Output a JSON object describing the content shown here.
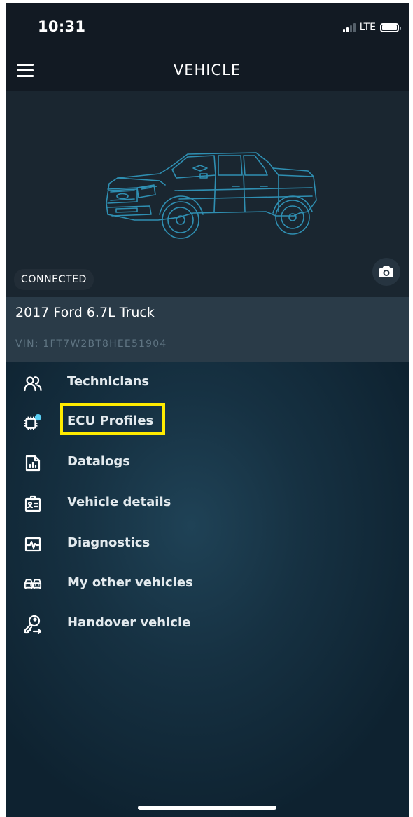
{
  "status_bar": {
    "time": "10:31",
    "network": "LTE"
  },
  "header": {
    "title": "VEHICLE"
  },
  "hero": {
    "connection_status": "CONNECTED"
  },
  "vehicle": {
    "name": "2017 Ford 6.7L Truck",
    "vin": "VIN: 1FT7W2BT8HEE51904"
  },
  "menu": {
    "items": [
      {
        "label": "Technicians",
        "icon": "technicians-icon"
      },
      {
        "label": "ECU Profiles",
        "icon": "ecu-chip-icon"
      },
      {
        "label": "Datalogs",
        "icon": "datalog-document-icon"
      },
      {
        "label": "Vehicle details",
        "icon": "id-card-icon"
      },
      {
        "label": "Diagnostics",
        "icon": "pulse-monitor-icon"
      },
      {
        "label": "My other vehicles",
        "icon": "vehicles-icon"
      },
      {
        "label": "Handover vehicle",
        "icon": "key-handover-icon"
      }
    ]
  },
  "colors": {
    "highlight": "#ffeb00",
    "notification_dot": "#5ad0f5",
    "header_bg": "#121a23",
    "truck_line": "#2f8fb2"
  }
}
